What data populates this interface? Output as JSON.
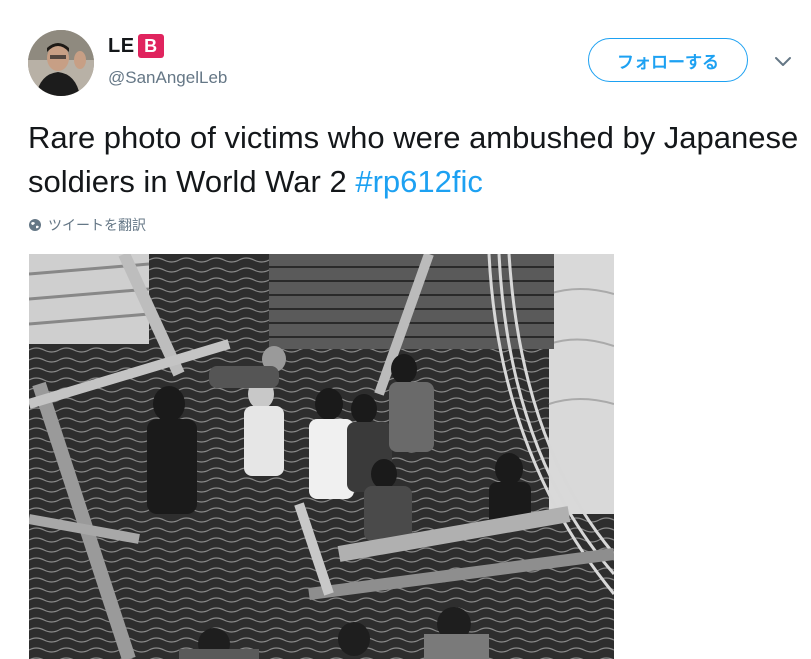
{
  "tweet": {
    "author": {
      "display_name": "LE",
      "badge_letter": "B",
      "handle": "@SanAngelLeb"
    },
    "follow_label": "フォローする",
    "text_main": "Rare photo of victims who were ambushed by Japanese soldiers in World War 2 ",
    "hashtag": "#rp612fic",
    "translate_label": "ツイートを翻訳"
  },
  "colors": {
    "accent": "#1da1f2",
    "badge": "#e0245e",
    "muted": "#657786",
    "text": "#14171a"
  },
  "icons": [
    "chevron-down-icon",
    "globe-icon"
  ]
}
